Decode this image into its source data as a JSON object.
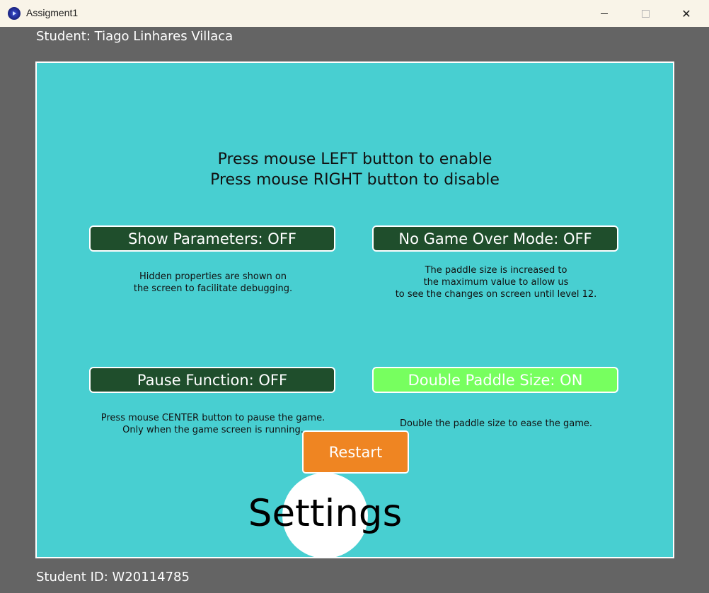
{
  "window": {
    "title": "Assigment1",
    "controls": {
      "minimize_icon": "minimize-icon",
      "maximize_icon": "maximize-icon",
      "close_icon": "close-icon",
      "close_glyph": "✕"
    }
  },
  "header": {
    "student_name": "Student: Tiago Linhares Villaca"
  },
  "footer": {
    "student_id": "Student ID: W20114785"
  },
  "panel": {
    "instruction_line1": "Press mouse LEFT button to enable",
    "instruction_line2": "Press mouse RIGHT button to disable",
    "options": {
      "show_parameters": {
        "label": "Show Parameters: OFF",
        "state": "off",
        "desc_line1": "Hidden properties are shown on",
        "desc_line2": "the screen to facilitate debugging."
      },
      "no_game_over": {
        "label": "No Game Over Mode: OFF",
        "state": "off",
        "desc_line1": "The paddle size is increased to",
        "desc_line2": "the maximum value to allow us",
        "desc_line3": "to see the changes on screen until level 12."
      },
      "pause_function": {
        "label": "Pause Function: OFF",
        "state": "off",
        "desc_line1": "Press mouse CENTER button to pause the game.",
        "desc_line2": "Only when the game screen is running."
      },
      "double_paddle": {
        "label": "Double Paddle Size: ON",
        "state": "on",
        "desc_line1": "Double the paddle size to ease the game."
      }
    },
    "restart_label": "Restart",
    "screen_title": "Settings"
  },
  "colors": {
    "window_bg": "#646464",
    "titlebar_bg": "#f9f4e8",
    "panel_bg": "#48cfd1",
    "button_off_bg": "#1f4e2c",
    "button_on_bg": "#77ff5f",
    "restart_bg": "#ef8522"
  }
}
